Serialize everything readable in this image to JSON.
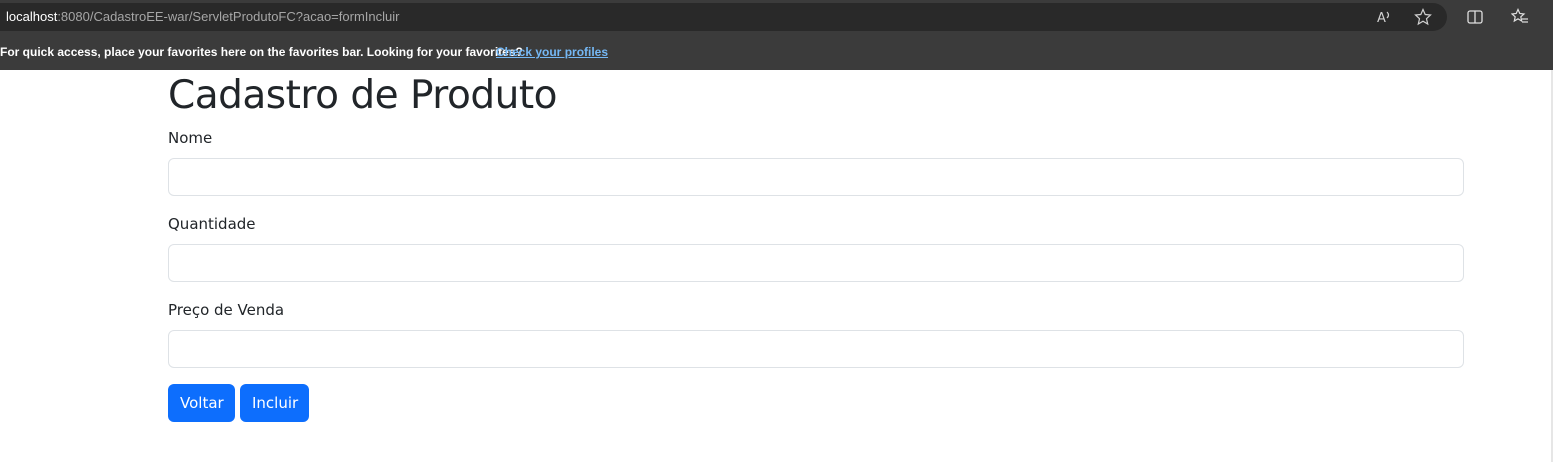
{
  "browser": {
    "url_host": "localhost",
    "url_path": ":8080/CadastroEE-war/ServletProdutoFC?acao=formIncluir",
    "icons": [
      "read-aloud-icon",
      "favorite-star-icon",
      "split-screen-icon",
      "favorites-list-icon"
    ]
  },
  "favorites_bar": {
    "message": "For quick access, place your favorites here on the favorites bar. Looking for your favorites?",
    "link": "Check your profiles"
  },
  "page": {
    "title": "Cadastro de Produto",
    "fields": [
      {
        "label": "Nome",
        "value": ""
      },
      {
        "label": "Quantidade",
        "value": ""
      },
      {
        "label": "Preço de Venda",
        "value": ""
      }
    ],
    "buttons": {
      "back": "Voltar",
      "submit": "Incluir"
    }
  },
  "colors": {
    "primary": "#0d6efd",
    "browser_chrome": "#3b3b3b",
    "link": "#75b8f5"
  }
}
